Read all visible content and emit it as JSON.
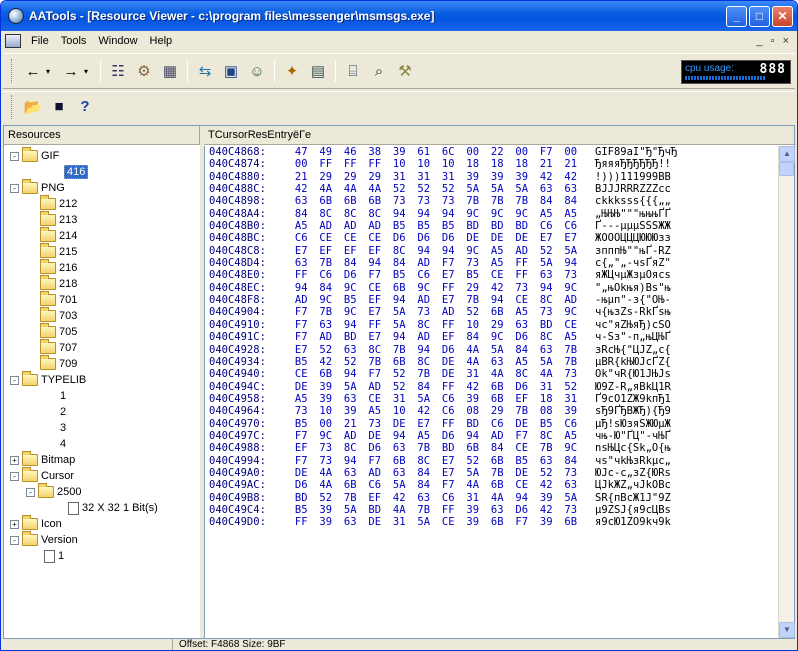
{
  "window": {
    "title": "AATools - [Resource Viewer - c:\\program files\\messenger\\msmsgs.exe]",
    "controls": {
      "minimize": "_",
      "maximize": "□",
      "close": "✕"
    }
  },
  "menu": {
    "items": [
      "File",
      "Tools",
      "Window",
      "Help"
    ],
    "mdi_controls": [
      "_",
      "▫",
      "×"
    ]
  },
  "cpu": {
    "label": "cpu usage:",
    "value": "888"
  },
  "panes": {
    "left_header": "Resources",
    "right_header": "TCursorResEntryëГe"
  },
  "tree": {
    "gif": "GIF",
    "gif_child": "416",
    "png": "PNG",
    "png_children": [
      "212",
      "213",
      "214",
      "215",
      "216",
      "218",
      "701",
      "703",
      "705",
      "707",
      "709"
    ],
    "typelib": "TYPELIB",
    "typelib_children": [
      "1",
      "2",
      "3",
      "4"
    ],
    "bitmap": "Bitmap",
    "cursor": "Cursor",
    "cursor_child": "2500",
    "cursor_leaf": "32 X 32 1 Bit(s)",
    "icon": "Icon",
    "version": "Version",
    "version_child": "1"
  },
  "hex_rows": [
    {
      "a": "040C4868:",
      "b": [
        "47",
        "49",
        "46",
        "38",
        "39",
        "61",
        "6C",
        "00",
        "22",
        "00",
        "F7",
        "00"
      ],
      "t": "GIF89aI\"Ђ\"ЂчЂ"
    },
    {
      "a": "040C4874:",
      "b": [
        "00",
        "FF",
        "FF",
        "FF",
        "10",
        "10",
        "10",
        "18",
        "18",
        "18",
        "21",
        "21"
      ],
      "t": "ЂяяяЂЂЂЂЂЂ!!"
    },
    {
      "a": "040C4880:",
      "b": [
        "21",
        "29",
        "29",
        "29",
        "31",
        "31",
        "31",
        "39",
        "39",
        "39",
        "42",
        "42"
      ],
      "t": "!)))111999BB"
    },
    {
      "a": "040C488C:",
      "b": [
        "42",
        "4A",
        "4A",
        "4A",
        "52",
        "52",
        "52",
        "5A",
        "5A",
        "5A",
        "63",
        "63"
      ],
      "t": "BJJJRRRZZZcc"
    },
    {
      "a": "040C4898:",
      "b": [
        "63",
        "6B",
        "6B",
        "6B",
        "73",
        "73",
        "73",
        "7B",
        "7B",
        "7B",
        "84",
        "84"
      ],
      "t": "ckkksss{{{„„"
    },
    {
      "a": "040C48A4:",
      "b": [
        "84",
        "8C",
        "8C",
        "8C",
        "94",
        "94",
        "94",
        "9C",
        "9C",
        "9C",
        "A5",
        "A5"
      ],
      "t": "„ЊЊЊ\"\"\"њњњҐҐ"
    },
    {
      "a": "040C48B0:",
      "b": [
        "A5",
        "AD",
        "AD",
        "AD",
        "B5",
        "B5",
        "B5",
        "BD",
        "BD",
        "BD",
        "C6",
        "C6"
      ],
      "t": "Ґ---µµµSSSЖЖ"
    },
    {
      "a": "040C48BC:",
      "b": [
        "C6",
        "CE",
        "CE",
        "CE",
        "D6",
        "D6",
        "D6",
        "DE",
        "DE",
        "DE",
        "E7",
        "E7"
      ],
      "t": "ЖОООЦЦЦЮЮЮзз"
    },
    {
      "a": "040C48C8:",
      "b": [
        "E7",
        "EF",
        "EF",
        "EF",
        "8C",
        "94",
        "94",
        "9C",
        "A5",
        "AD",
        "52",
        "5A"
      ],
      "t": "зпппЊ\"\"њҐ-RZ"
    },
    {
      "a": "040C48D4:",
      "b": [
        "63",
        "7B",
        "84",
        "94",
        "84",
        "AD",
        "F7",
        "73",
        "A5",
        "FF",
        "5A",
        "94"
      ],
      "t": "c{„\"„-чsҐяZ\""
    },
    {
      "a": "040C48E0:",
      "b": [
        "FF",
        "C6",
        "D6",
        "F7",
        "B5",
        "C6",
        "E7",
        "B5",
        "CE",
        "FF",
        "63",
        "73"
      ],
      "t": "яЖЦчµЖзµОяcs"
    },
    {
      "a": "040C48EC:",
      "b": [
        "94",
        "84",
        "9C",
        "CE",
        "6B",
        "9C",
        "FF",
        "29",
        "42",
        "73",
        "94",
        "9C"
      ],
      "t": "\"„њОkњя)Bs\"њ"
    },
    {
      "a": "040C48F8:",
      "b": [
        "AD",
        "9C",
        "B5",
        "EF",
        "94",
        "AD",
        "E7",
        "7B",
        "94",
        "CE",
        "8C",
        "AD"
      ],
      "t": "-њµп\"-з{\"ОЊ-"
    },
    {
      "a": "040C4904:",
      "b": [
        "F7",
        "7B",
        "9C",
        "E7",
        "5A",
        "73",
        "AD",
        "52",
        "6B",
        "A5",
        "73",
        "9C"
      ],
      "t": "ч{њзZs-RkҐsњ"
    },
    {
      "a": "040C4910:",
      "b": [
        "F7",
        "63",
        "94",
        "FF",
        "5A",
        "8C",
        "FF",
        "10",
        "29",
        "63",
        "BD",
        "CE"
      ],
      "t": "чc\"яZЊяЂ)cЅО"
    },
    {
      "a": "040C491C:",
      "b": [
        "F7",
        "AD",
        "BD",
        "E7",
        "94",
        "AD",
        "EF",
        "84",
        "9C",
        "D6",
        "8C",
        "A5"
      ],
      "t": "ч-Ѕз\"-п„њЦЊҐ"
    },
    {
      "a": "040C4928:",
      "b": [
        "E7",
        "52",
        "63",
        "8C",
        "7B",
        "94",
        "D6",
        "4A",
        "5A",
        "84",
        "63",
        "7B"
      ],
      "t": "зRcЊ{\"ЦJZ„c{"
    },
    {
      "a": "040C4934:",
      "b": [
        "B5",
        "42",
        "52",
        "7B",
        "6B",
        "8C",
        "DE",
        "4A",
        "63",
        "A5",
        "5A",
        "7B"
      ],
      "t": "µBR{kЊЮJcҐZ{"
    },
    {
      "a": "040C4940:",
      "b": [
        "CE",
        "6B",
        "94",
        "F7",
        "52",
        "7B",
        "DE",
        "31",
        "4A",
        "8C",
        "4A",
        "73"
      ],
      "t": "Оk\"чR{Ю1JЊJs"
    },
    {
      "a": "040C494C:",
      "b": [
        "DE",
        "39",
        "5A",
        "AD",
        "52",
        "84",
        "FF",
        "42",
        "6B",
        "D6",
        "31",
        "52"
      ],
      "t": "Ю9Z-R„яBkЦ1R"
    },
    {
      "a": "040C4958:",
      "b": [
        "A5",
        "39",
        "63",
        "CE",
        "31",
        "5A",
        "C6",
        "39",
        "6B",
        "EF",
        "18",
        "31"
      ],
      "t": "Ґ9cО1ZЖ9kпЂ1"
    },
    {
      "a": "040C4964:",
      "b": [
        "73",
        "10",
        "39",
        "A5",
        "10",
        "42",
        "C6",
        "08",
        "29",
        "7B",
        "08",
        "39"
      ],
      "t": "sЂ9ҐЂBЖЂ){Ђ9"
    },
    {
      "a": "040C4970:",
      "b": [
        "B5",
        "00",
        "21",
        "73",
        "DE",
        "E7",
        "FF",
        "BD",
        "C6",
        "DE",
        "B5",
        "C6"
      ],
      "t": "µЂ!sЮзяЅЖЮµЖ"
    },
    {
      "a": "040C497C:",
      "b": [
        "F7",
        "9C",
        "AD",
        "DE",
        "94",
        "A5",
        "D6",
        "94",
        "AD",
        "F7",
        "8C",
        "A5"
      ],
      "t": "чњ-Ю\"ҐЦ\"-чЊҐ"
    },
    {
      "a": "040C4988:",
      "b": [
        "EF",
        "73",
        "8C",
        "D6",
        "63",
        "7B",
        "BD",
        "6B",
        "84",
        "CE",
        "7B",
        "9C"
      ],
      "t": "nsЊЦc{Ѕk„О{њ"
    },
    {
      "a": "040C4994:",
      "b": [
        "F7",
        "73",
        "94",
        "F7",
        "6B",
        "8C",
        "E7",
        "52",
        "6B",
        "B5",
        "63",
        "84"
      ],
      "t": "чs\"чkЊзRkµc„"
    },
    {
      "a": "040C49A0:",
      "b": [
        "DE",
        "4A",
        "63",
        "AD",
        "63",
        "84",
        "E7",
        "5A",
        "7B",
        "DE",
        "52",
        "73"
      ],
      "t": "ЮJc-c„зZ{ЮRs"
    },
    {
      "a": "040C49AC:",
      "b": [
        "D6",
        "4A",
        "6B",
        "C6",
        "5A",
        "84",
        "F7",
        "4A",
        "6B",
        "CE",
        "42",
        "63"
      ],
      "t": "ЦJkЖZ„чJkОBc"
    },
    {
      "a": "040C49B8:",
      "b": [
        "BD",
        "52",
        "7B",
        "EF",
        "42",
        "63",
        "C6",
        "31",
        "4A",
        "94",
        "39",
        "5A"
      ],
      "t": "ЅR{пBcЖ1J\"9Z"
    },
    {
      "a": "040C49C4:",
      "b": [
        "B5",
        "39",
        "5A",
        "BD",
        "4A",
        "7B",
        "FF",
        "39",
        "63",
        "D6",
        "42",
        "73"
      ],
      "t": "µ9ZЅJ{я9cЦBs"
    },
    {
      "a": "040C49D0:",
      "b": [
        "FF",
        "39",
        "63",
        "DE",
        "31",
        "5A",
        "CE",
        "39",
        "6B",
        "F7",
        "39",
        "6B"
      ],
      "t": "я9cЮ1ZО9kч9k"
    }
  ],
  "status": {
    "text": "Offset: F4868  Size: 9BF"
  }
}
